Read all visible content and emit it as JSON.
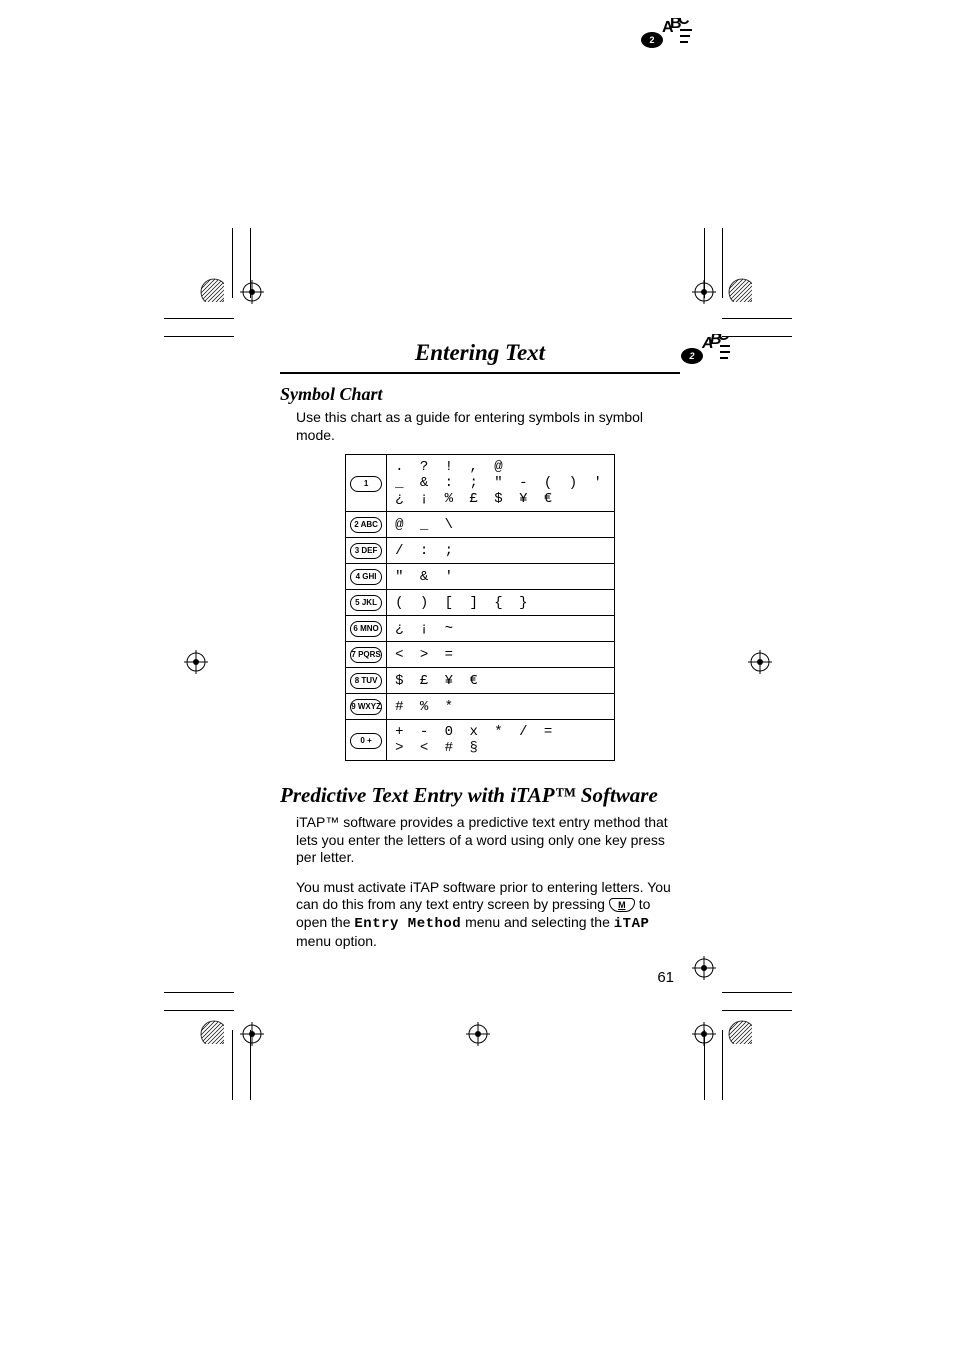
{
  "header": {
    "running": "Entering Text"
  },
  "section_symbol": {
    "title": "Symbol Chart",
    "intro": "Use this chart as a guide for entering symbols in symbol mode."
  },
  "symbol_table": [
    {
      "key": "1",
      "chars": ". ? ! , @\n_ & : ; \" - ( ) '\n¿ ¡ % £ $ ¥ €"
    },
    {
      "key": "2 ABC",
      "chars": "@ _ \\"
    },
    {
      "key": "3 DEF",
      "chars": "/ : ;"
    },
    {
      "key": "4 GHI",
      "chars": "\" & '"
    },
    {
      "key": "5 JKL",
      "chars": "( ) [ ] { }"
    },
    {
      "key": "6 MNO",
      "chars": "¿ ¡ ~"
    },
    {
      "key": "7 PQRS",
      "chars": "< > ="
    },
    {
      "key": "8 TUV",
      "chars": "$ £ ¥ €"
    },
    {
      "key": "9 WXYZ",
      "chars": "# % *"
    },
    {
      "key": "0 +",
      "chars": "+ - 0 x * / =\n> < # §"
    }
  ],
  "section_itap": {
    "title": "Predictive Text Entry with iTAP™ Software",
    "p1": "iTAP™ software provides a predictive text entry method that lets you enter the letters of a word using only one key press per letter.",
    "p2a": "You must activate iTAP software prior to entering letters. You can do this from any text entry screen by pressing ",
    "p2b": " to open the ",
    "entry_method": "Entry Method",
    "p2c": " menu and selecting the ",
    "itap_label": "iTAP",
    "p2d": " menu option.",
    "menu_key": "M"
  },
  "page_number": "61"
}
